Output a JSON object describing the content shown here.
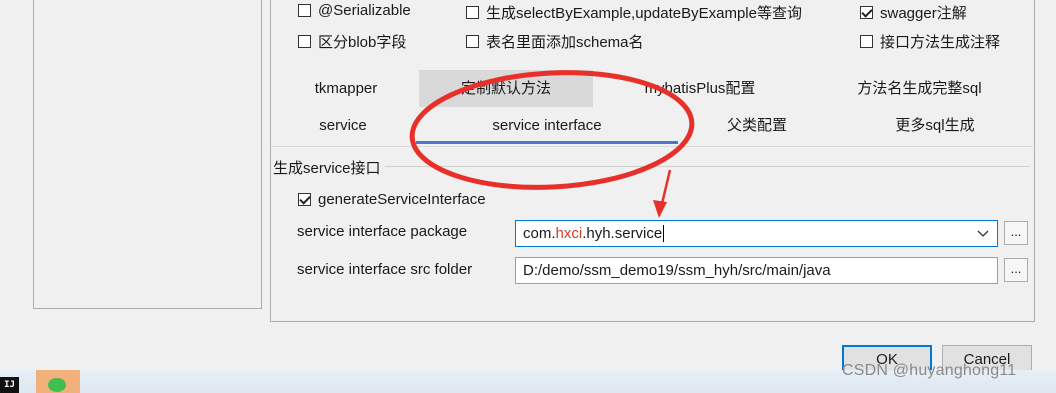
{
  "options_row1": {
    "serializable": {
      "label": "@Serializable",
      "checked": false
    },
    "select_by_example": {
      "label": "生成selectByExample,updateByExample等查询",
      "checked": false
    },
    "swagger": {
      "label": "swagger注解",
      "checked": true
    }
  },
  "options_row2": {
    "blob": {
      "label": "区分blob字段",
      "checked": false
    },
    "schema": {
      "label": "表名里面添加schema名",
      "checked": false
    },
    "method_comment": {
      "label": "接口方法生成注释",
      "checked": false
    }
  },
  "tabs_row1": [
    "tkmapper",
    "定制默认方法",
    "mybatisPlus配置",
    "方法名生成完整sql"
  ],
  "tabs_row2": [
    "service",
    "service interface",
    "父类配置",
    "更多sql生成"
  ],
  "active_tab": "service interface",
  "group": {
    "title": "生成service接口",
    "generate_checkbox": {
      "label": "generateServiceInterface",
      "checked": true
    }
  },
  "fields": {
    "package": {
      "label": "service interface package",
      "value_prefix": "com.",
      "value_highlight": "hxci",
      "value_suffix": ".hyh.service"
    },
    "src_folder": {
      "label": "service interface src folder",
      "value": "D:/demo/ssm_demo19/ssm_hyh/src/main/java"
    },
    "browse_label": "..."
  },
  "buttons": {
    "ok": "OK",
    "cancel": "Cancel"
  },
  "taskbar": {
    "ij_label": "IJ"
  },
  "watermark": "CSDN @huyanghong11",
  "colors": {
    "accent": "#0078d7",
    "tab_underline": "#4b78c8",
    "annotation_red": "#e8302a"
  }
}
